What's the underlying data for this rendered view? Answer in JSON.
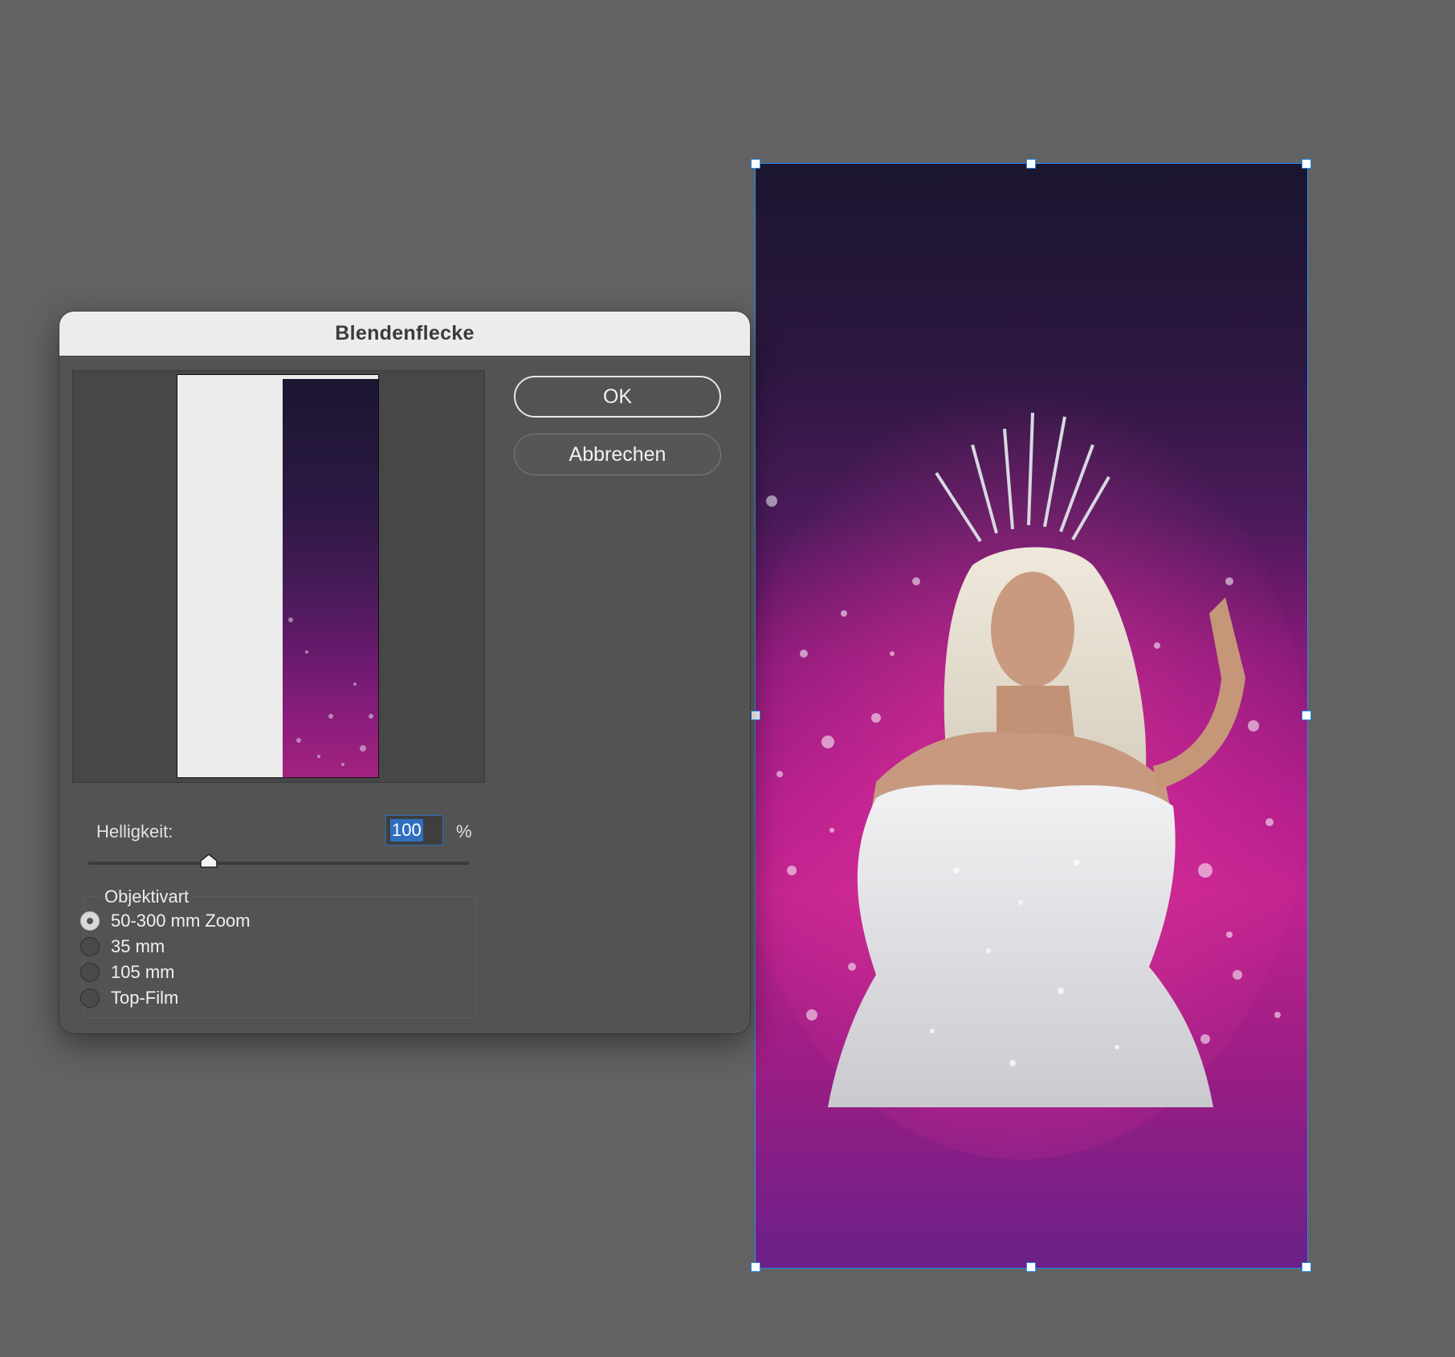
{
  "dialog": {
    "title": "Blendenflecke",
    "ok_label": "OK",
    "cancel_label": "Abbrechen",
    "brightness": {
      "label": "Helligkeit:",
      "value": "100",
      "unit": "%",
      "slider_fraction": 0.3
    },
    "lens_group": {
      "title": "Objektivart",
      "options": [
        {
          "label": "50-300 mm Zoom",
          "selected": true
        },
        {
          "label": "35 mm",
          "selected": false
        },
        {
          "label": "105 mm",
          "selected": false
        },
        {
          "label": "Top-Film",
          "selected": false
        }
      ]
    }
  },
  "colors": {
    "workspace": "#626262",
    "dialog_bg": "#535353",
    "titlebar_bg": "#ececec",
    "selection": "#2a8cf0",
    "image_magenta": "#c0238f",
    "image_dark": "#1b1530"
  }
}
